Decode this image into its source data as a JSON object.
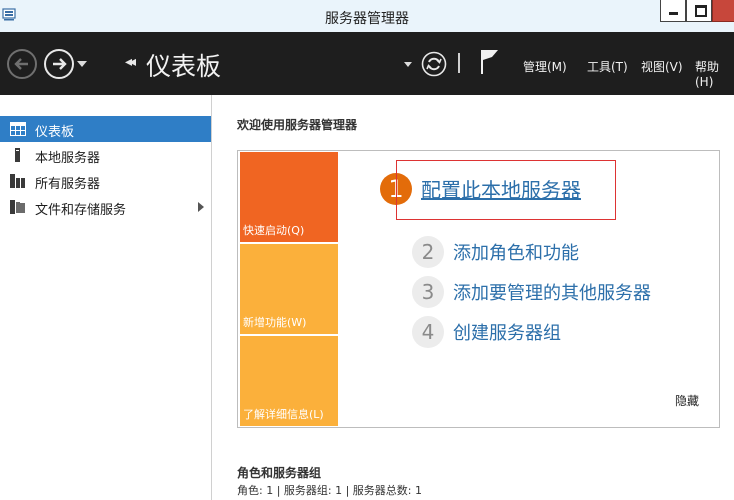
{
  "window": {
    "title": "服务器管理器",
    "icon": "server-manager-icon"
  },
  "header": {
    "breadcrumb_title": "仪表板",
    "menus": [
      "管理(M)",
      "工具(T)",
      "视图(V)",
      "帮助(H)"
    ]
  },
  "sidebar": {
    "items": [
      {
        "label": "仪表板",
        "icon": "dashboard-icon",
        "selected": true
      },
      {
        "label": "本地服务器",
        "icon": "local-server-icon"
      },
      {
        "label": "所有服务器",
        "icon": "all-servers-icon"
      },
      {
        "label": "文件和存储服务",
        "icon": "file-storage-icon",
        "expandable": true
      }
    ]
  },
  "main": {
    "welcome": "欢迎使用服务器管理器",
    "tiles": [
      "快速启动(Q)",
      "新增功能(W)",
      "了解详细信息(L)"
    ],
    "steps": [
      {
        "num": "1",
        "text": "配置此本地服务器"
      },
      {
        "num": "2",
        "text": "添加角色和功能"
      },
      {
        "num": "3",
        "text": "添加要管理的其他服务器"
      },
      {
        "num": "4",
        "text": "创建服务器组"
      }
    ],
    "hide": "隐藏",
    "section_title": "角色和服务器组",
    "section_sub": "角色: 1 | 服务器组: 1 | 服务器总数: 1"
  },
  "colors": {
    "header_bg": "#1e1e1e",
    "selected_bg": "#2f7ec6",
    "tile_orange": "#f06522",
    "tile_yellow": "#fbb03b",
    "link_blue": "#2c6faa",
    "step1_circle": "#e36c0a"
  }
}
